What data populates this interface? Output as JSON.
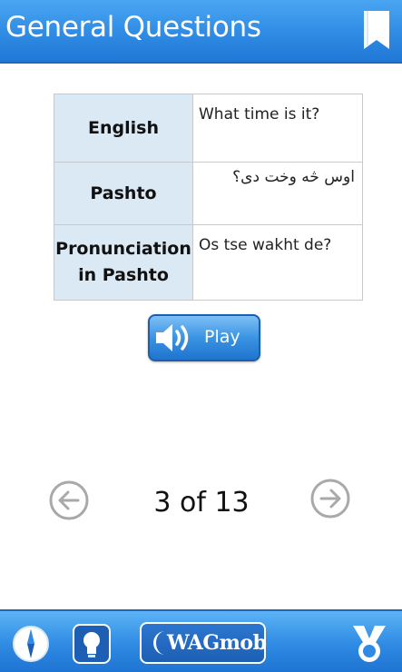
{
  "header": {
    "title": "General Questions",
    "bookmark_icon": "bookmark-icon"
  },
  "phrase": {
    "rows": [
      {
        "label": "English",
        "value": "What time is it?"
      },
      {
        "label": "Pashto",
        "value": "اوس څه وخت دی؟"
      },
      {
        "label": "Pronunciation in Pashto",
        "value": "Os tse wakht de?"
      }
    ]
  },
  "play": {
    "label": "Play",
    "icon": "speaker-icon"
  },
  "pagination": {
    "current": 3,
    "total": 13,
    "text": "3 of 13",
    "prev_icon": "arrow-left-circle-icon",
    "next_icon": "arrow-right-circle-icon"
  },
  "footer": {
    "brand_label": "WAGmob",
    "icons": [
      "compass-icon",
      "lightbulb-icon",
      "moon-icon",
      "award-icon"
    ]
  },
  "colors": {
    "header_blue": "#2f8be3",
    "label_cell": "#dbe9f5",
    "nav_gray": "#a9a9a9"
  }
}
